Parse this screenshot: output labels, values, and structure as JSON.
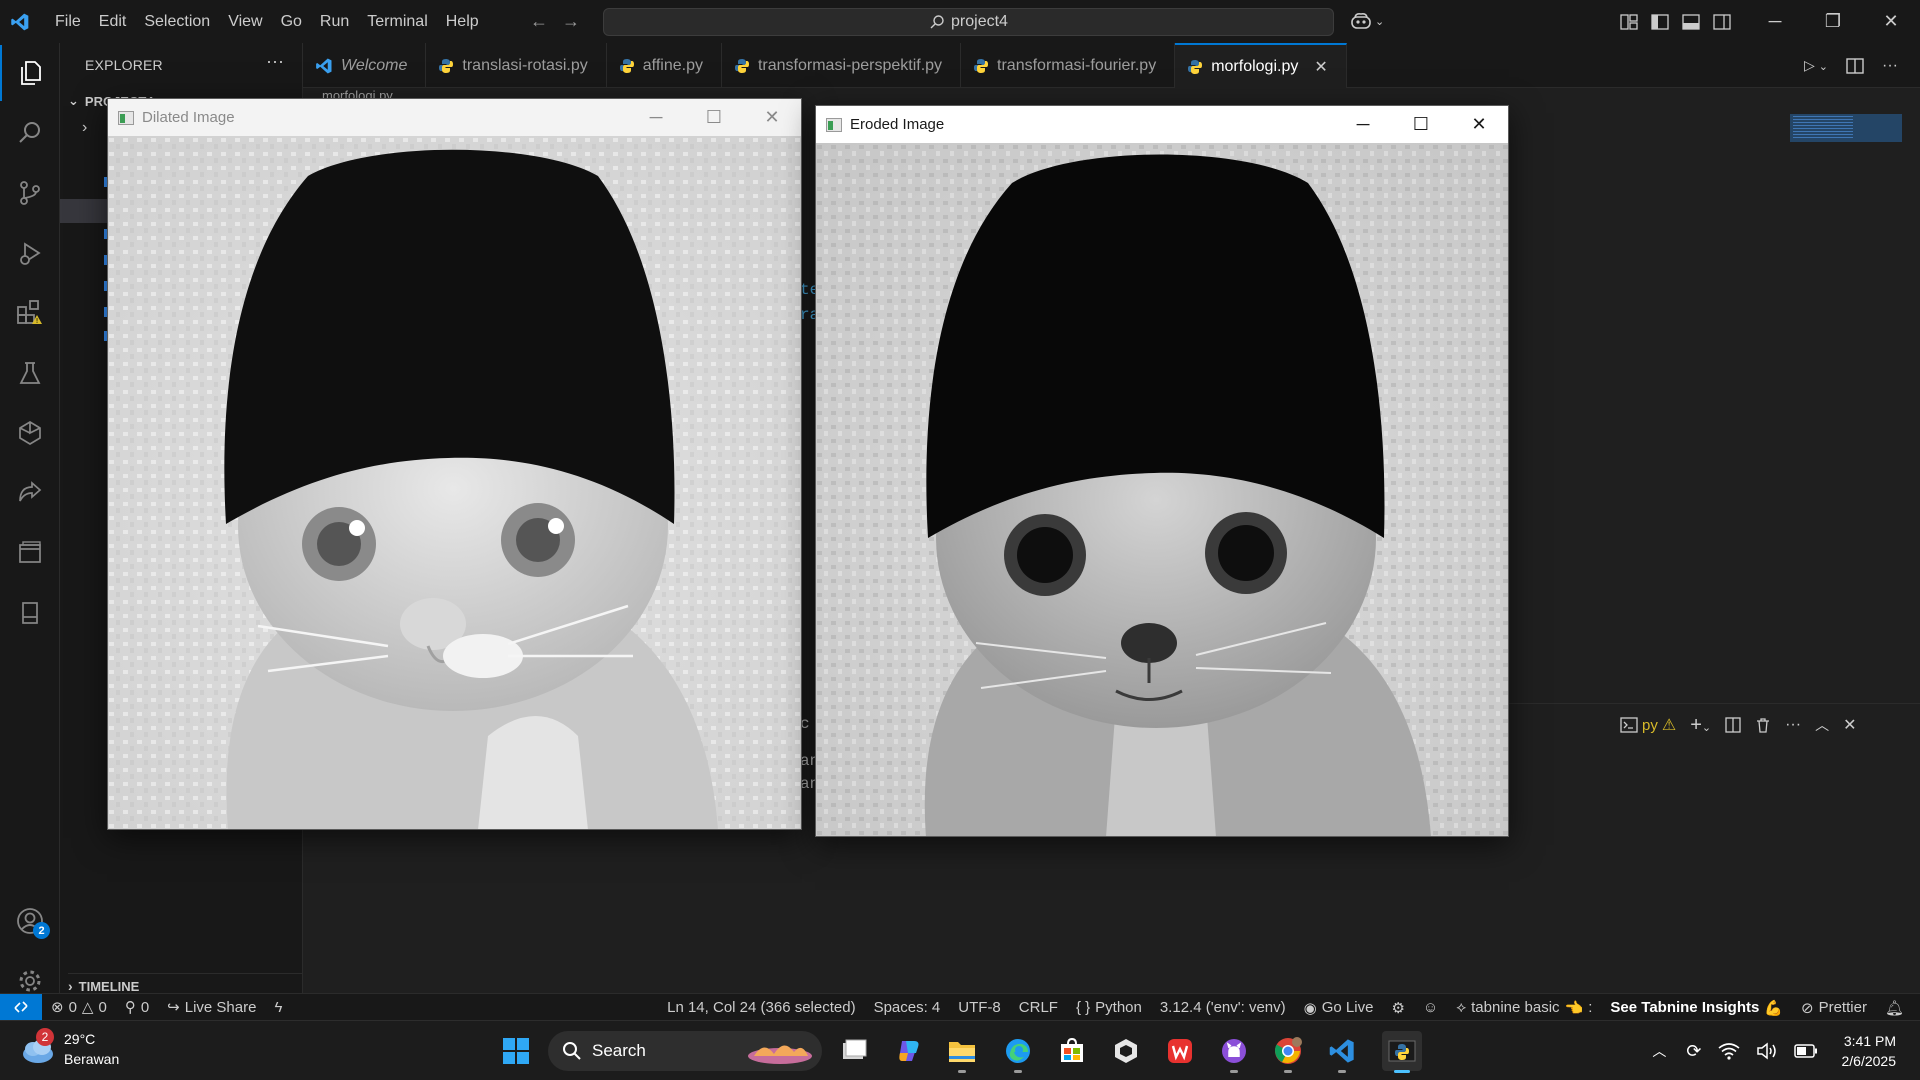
{
  "titlebar": {
    "menu": [
      "File",
      "Edit",
      "Selection",
      "View",
      "Go",
      "Run",
      "Terminal",
      "Help"
    ],
    "search_text": "project4"
  },
  "sidebar": {
    "title": "EXPLORER",
    "project_section": "PROJECT4",
    "timeline_section": "TIMELINE"
  },
  "tabs": [
    {
      "label": "Welcome",
      "italic": true,
      "icon": "vscode-icon"
    },
    {
      "label": "translasi-rotasi.py",
      "icon": "python-icon"
    },
    {
      "label": "affine.py",
      "icon": "python-icon"
    },
    {
      "label": "transformasi-perspektif.py",
      "icon": "python-icon"
    },
    {
      "label": "transformasi-fourier.py",
      "icon": "python-icon"
    },
    {
      "label": "morfologi.py",
      "icon": "python-icon",
      "active": true
    }
  ],
  "breadcrumb": "morfologi.py",
  "code_fragments": [
    "te",
    "ra",
    "c",
    "an",
    "an"
  ],
  "panel": {
    "terminal_label": "py"
  },
  "windows": {
    "dilated": {
      "title": "Dilated Image"
    },
    "eroded": {
      "title": "Eroded Image"
    }
  },
  "statusbar": {
    "errors": "0",
    "warnings": "0",
    "ports": "0",
    "live_share": "Live Share",
    "position": "Ln 14, Col 24 (366 selected)",
    "spaces": "Spaces: 4",
    "encoding": "UTF-8",
    "eol": "CRLF",
    "language": "Python",
    "interpreter": "3.12.4 ('env': venv)",
    "go_live": "Go Live",
    "tabnine": "tabnine basic",
    "tabnine_insights": "See Tabnine Insights",
    "prettier": "Prettier"
  },
  "taskbar": {
    "weather_badge": "2",
    "temperature": "29°C",
    "condition": "Berawan",
    "search_label": "Search",
    "time": "3:41 PM",
    "date": "2/6/2025"
  },
  "accounts_badge": "2",
  "colors": {
    "accent": "#0078d4",
    "bg": "#1f1f1f",
    "chrome": "#181818"
  }
}
